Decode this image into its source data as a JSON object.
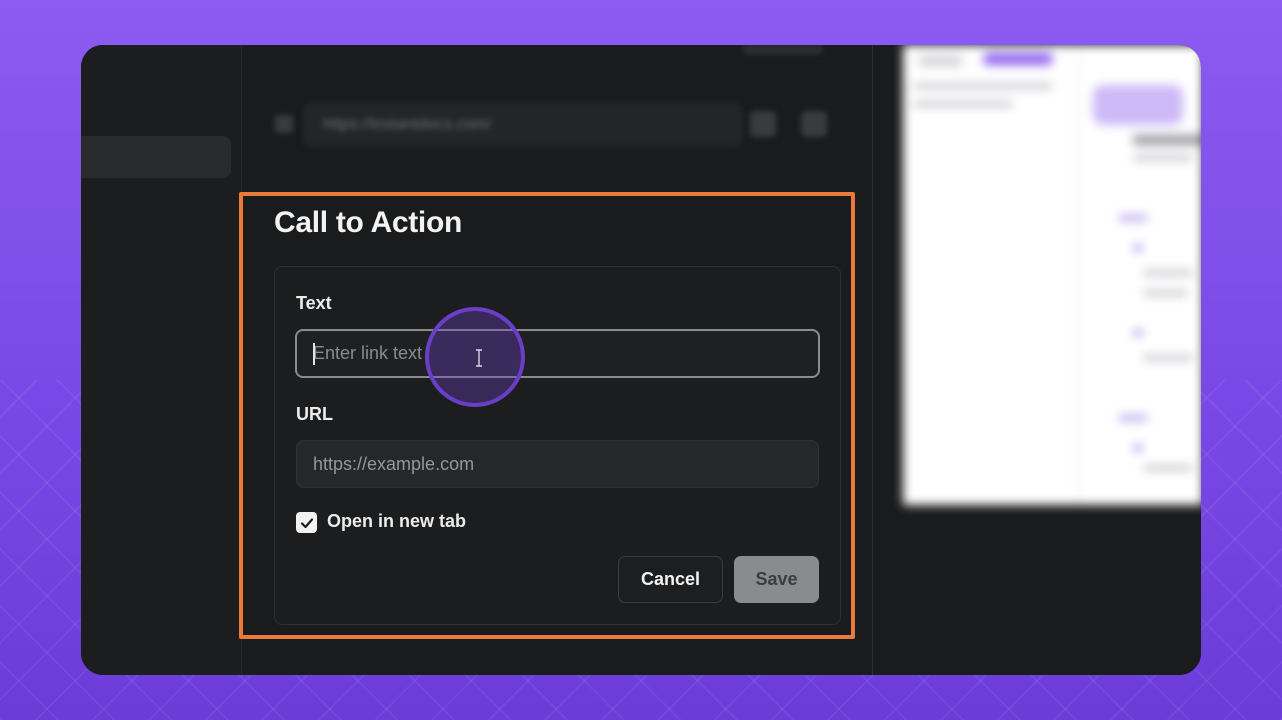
{
  "editor": {
    "url_bar_text": "https://instantdocs.com/"
  },
  "cta_dialog": {
    "title": "Call to Action",
    "text_field": {
      "label": "Text",
      "value": "",
      "placeholder": "Enter link text"
    },
    "url_field": {
      "label": "URL",
      "value": "",
      "placeholder": "https://example.com"
    },
    "open_new_tab": {
      "label": "Open in new tab",
      "checked": true
    },
    "cancel_label": "Cancel",
    "save_label": "Save"
  },
  "colors": {
    "background_accent": "#8d5bf0",
    "highlight_border": "#e97a3a",
    "cursor_ring": "#6a3fc7",
    "panel": "#1a1b1c",
    "save_disabled": "#8a8b8d"
  },
  "icons": {
    "checkbox": "check-icon",
    "cursor": "text-cursor-icon"
  }
}
